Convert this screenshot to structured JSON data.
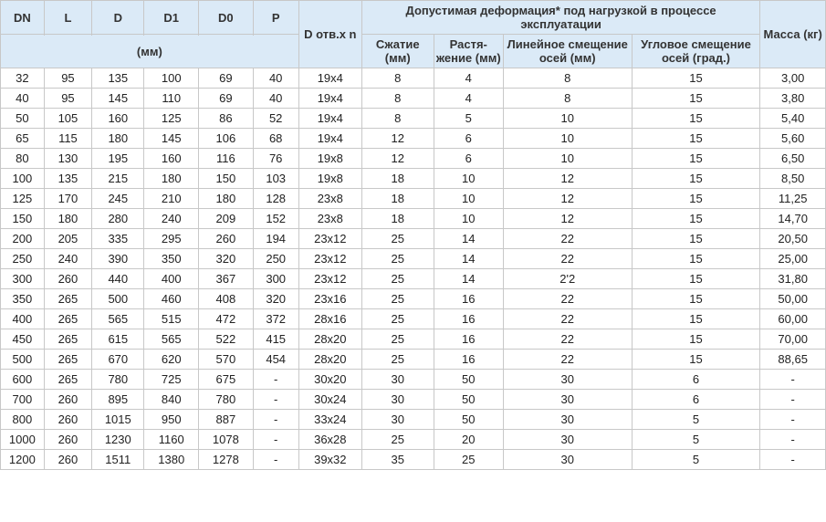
{
  "headers": {
    "dn": "DN",
    "l": "L",
    "d": "D",
    "d1": "D1",
    "d0": "D0",
    "p": "P",
    "d_otv": "D отв.x n",
    "deform_group": "Допустимая деформация* под нагрузкой в процессе эксплуатации",
    "mass": "Масса (кг)",
    "mm_unit": "(мм)",
    "szh": "Сжатие (мм)",
    "rast": "Растя- жение (мм)",
    "lin": "Линейное смещение осей (мм)",
    "ugl": "Угловое смещение осей (град.)"
  },
  "rows": [
    {
      "dn": "32",
      "l": "95",
      "d": "135",
      "d1": "100",
      "d0": "69",
      "p": "40",
      "dotv": "19x4",
      "sz": "8",
      "rz": "4",
      "lin": "8",
      "ug": "15",
      "mass": "3,00"
    },
    {
      "dn": "40",
      "l": "95",
      "d": "145",
      "d1": "110",
      "d0": "69",
      "p": "40",
      "dotv": "19x4",
      "sz": "8",
      "rz": "4",
      "lin": "8",
      "ug": "15",
      "mass": "3,80"
    },
    {
      "dn": "50",
      "l": "105",
      "d": "160",
      "d1": "125",
      "d0": "86",
      "p": "52",
      "dotv": "19x4",
      "sz": "8",
      "rz": "5",
      "lin": "10",
      "ug": "15",
      "mass": "5,40"
    },
    {
      "dn": "65",
      "l": "115",
      "d": "180",
      "d1": "145",
      "d0": "106",
      "p": "68",
      "dotv": "19x4",
      "sz": "12",
      "rz": "6",
      "lin": "10",
      "ug": "15",
      "mass": "5,60"
    },
    {
      "dn": "80",
      "l": "130",
      "d": "195",
      "d1": "160",
      "d0": "116",
      "p": "76",
      "dotv": "19x8",
      "sz": "12",
      "rz": "6",
      "lin": "10",
      "ug": "15",
      "mass": "6,50"
    },
    {
      "dn": "100",
      "l": "135",
      "d": "215",
      "d1": "180",
      "d0": "150",
      "p": "103",
      "dotv": "19x8",
      "sz": "18",
      "rz": "10",
      "lin": "12",
      "ug": "15",
      "mass": "8,50"
    },
    {
      "dn": "125",
      "l": "170",
      "d": "245",
      "d1": "210",
      "d0": "180",
      "p": "128",
      "dotv": "23x8",
      "sz": "18",
      "rz": "10",
      "lin": "12",
      "ug": "15",
      "mass": "11,25"
    },
    {
      "dn": "150",
      "l": "180",
      "d": "280",
      "d1": "240",
      "d0": "209",
      "p": "152",
      "dotv": "23x8",
      "sz": "18",
      "rz": "10",
      "lin": "12",
      "ug": "15",
      "mass": "14,70"
    },
    {
      "dn": "200",
      "l": "205",
      "d": "335",
      "d1": "295",
      "d0": "260",
      "p": "194",
      "dotv": "23x12",
      "sz": "25",
      "rz": "14",
      "lin": "22",
      "ug": "15",
      "mass": "20,50"
    },
    {
      "dn": "250",
      "l": "240",
      "d": "390",
      "d1": "350",
      "d0": "320",
      "p": "250",
      "dotv": "23x12",
      "sz": "25",
      "rz": "14",
      "lin": "22",
      "ug": "15",
      "mass": "25,00"
    },
    {
      "dn": "300",
      "l": "260",
      "d": "440",
      "d1": "400",
      "d0": "367",
      "p": "300",
      "dotv": "23x12",
      "sz": "25",
      "rz": "14",
      "lin": "2'2",
      "ug": "15",
      "mass": "31,80"
    },
    {
      "dn": "350",
      "l": "265",
      "d": "500",
      "d1": "460",
      "d0": "408",
      "p": "320",
      "dotv": "23x16",
      "sz": "25",
      "rz": "16",
      "lin": "22",
      "ug": "15",
      "mass": "50,00"
    },
    {
      "dn": "400",
      "l": "265",
      "d": "565",
      "d1": "515",
      "d0": "472",
      "p": "372",
      "dotv": "28x16",
      "sz": "25",
      "rz": "16",
      "lin": "22",
      "ug": "15",
      "mass": "60,00"
    },
    {
      "dn": "450",
      "l": "265",
      "d": "615",
      "d1": "565",
      "d0": "522",
      "p": "415",
      "dotv": "28x20",
      "sz": "25",
      "rz": "16",
      "lin": "22",
      "ug": "15",
      "mass": "70,00"
    },
    {
      "dn": "500",
      "l": "265",
      "d": "670",
      "d1": "620",
      "d0": "570",
      "p": "454",
      "dotv": "28x20",
      "sz": "25",
      "rz": "16",
      "lin": "22",
      "ug": "15",
      "mass": "88,65"
    },
    {
      "dn": "600",
      "l": "265",
      "d": "780",
      "d1": "725",
      "d0": "675",
      "p": "-",
      "dotv": "30x20",
      "sz": "30",
      "rz": "50",
      "lin": "30",
      "ug": "6",
      "mass": "-"
    },
    {
      "dn": "700",
      "l": "260",
      "d": "895",
      "d1": "840",
      "d0": "780",
      "p": "-",
      "dotv": "30x24",
      "sz": "30",
      "rz": "50",
      "lin": "30",
      "ug": "6",
      "mass": "-"
    },
    {
      "dn": "800",
      "l": "260",
      "d": "1015",
      "d1": "950",
      "d0": "887",
      "p": "-",
      "dotv": "33x24",
      "sz": "30",
      "rz": "50",
      "lin": "30",
      "ug": "5",
      "mass": "-"
    },
    {
      "dn": "1000",
      "l": "260",
      "d": "1230",
      "d1": "1160",
      "d0": "1078",
      "p": "-",
      "dotv": "36x28",
      "sz": "25",
      "rz": "20",
      "lin": "30",
      "ug": "5",
      "mass": "-"
    },
    {
      "dn": "1200",
      "l": "260",
      "d": "1511",
      "d1": "1380",
      "d0": "1278",
      "p": "-",
      "dotv": "39x32",
      "sz": "35",
      "rz": "25",
      "lin": "30",
      "ug": "5",
      "mass": "-"
    }
  ]
}
